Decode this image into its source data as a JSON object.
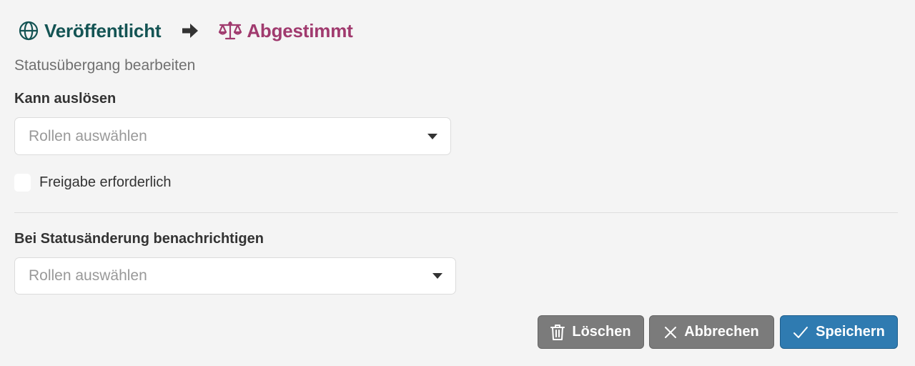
{
  "transition": {
    "from_label": "Veröffentlicht",
    "from_icon": "globe-icon",
    "arrow_icon": "arrow-right-icon",
    "to_label": "Abgestimmt",
    "to_icon": "balance-scale-icon"
  },
  "subtitle": "Statusübergang bearbeiten",
  "trigger": {
    "label": "Kann auslösen",
    "placeholder": "Rollen auswählen"
  },
  "approval": {
    "label": "Freigabe erforderlich",
    "checked": false
  },
  "notify": {
    "label": "Bei Statusänderung benachrichtigen",
    "placeholder": "Rollen auswählen"
  },
  "buttons": {
    "delete_label": "Löschen",
    "delete_icon": "trash-icon",
    "cancel_label": "Abbrechen",
    "cancel_icon": "close-icon",
    "save_label": "Speichern",
    "save_icon": "check-icon"
  },
  "colors": {
    "from_status": "#145454",
    "to_status": "#a03a6e",
    "save_button": "#2f7bb1",
    "secondary_button": "#7b7b7b"
  }
}
